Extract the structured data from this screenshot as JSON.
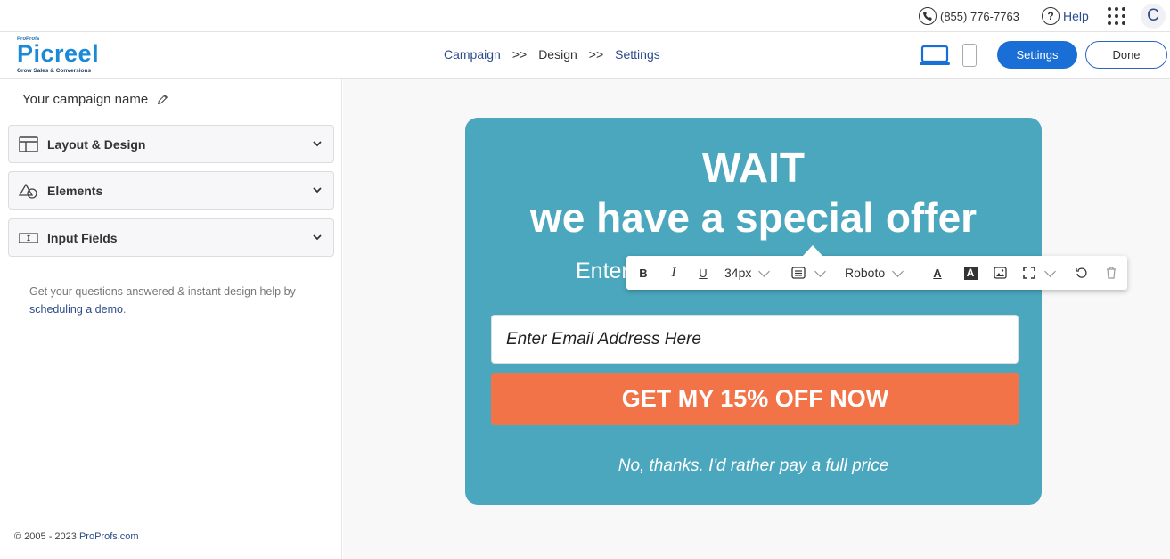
{
  "topbar": {
    "phone": "(855) 776-7763",
    "help": "Help",
    "avatar_initial": "C"
  },
  "header": {
    "logo_top": "ProProfs",
    "logo_name": "Picreel",
    "logo_tagline": "Grow Sales & Conversions",
    "breadcrumbs": [
      "Campaign",
      ">>",
      "Design",
      ">>",
      "Settings"
    ],
    "settings_label": "Settings",
    "done_label": "Done"
  },
  "sidebar": {
    "campaign_name": "Your campaign name",
    "sections": [
      {
        "label": "Layout & Design",
        "icon": "layout-icon"
      },
      {
        "label": "Elements",
        "icon": "shapes-icon"
      },
      {
        "label": "Input Fields",
        "icon": "input-field-icon"
      }
    ],
    "help_text": "Get your questions answered & instant design help by",
    "help_link": "scheduling a demo",
    "help_suffix": ".",
    "footer_text": "© 2005 - 2023",
    "footer_link": "ProProfs.com"
  },
  "popup": {
    "heading_line1": "WAIT",
    "heading_line2": "we have a special offer",
    "subheading_visible": "Enter",
    "email_placeholder": "Enter Email Address Here",
    "cta_label": "GET MY 15% OFF NOW",
    "decline_label": "No, thanks. I'd rather pay a full price",
    "bg_color": "#4ba7be",
    "cta_color": "#f27348"
  },
  "toolbar": {
    "bold": "B",
    "italic": "I",
    "underline": "U",
    "font_size": "34px",
    "font_family": "Roboto",
    "text_color_glyph": "A",
    "bg_color_glyph": "A"
  }
}
